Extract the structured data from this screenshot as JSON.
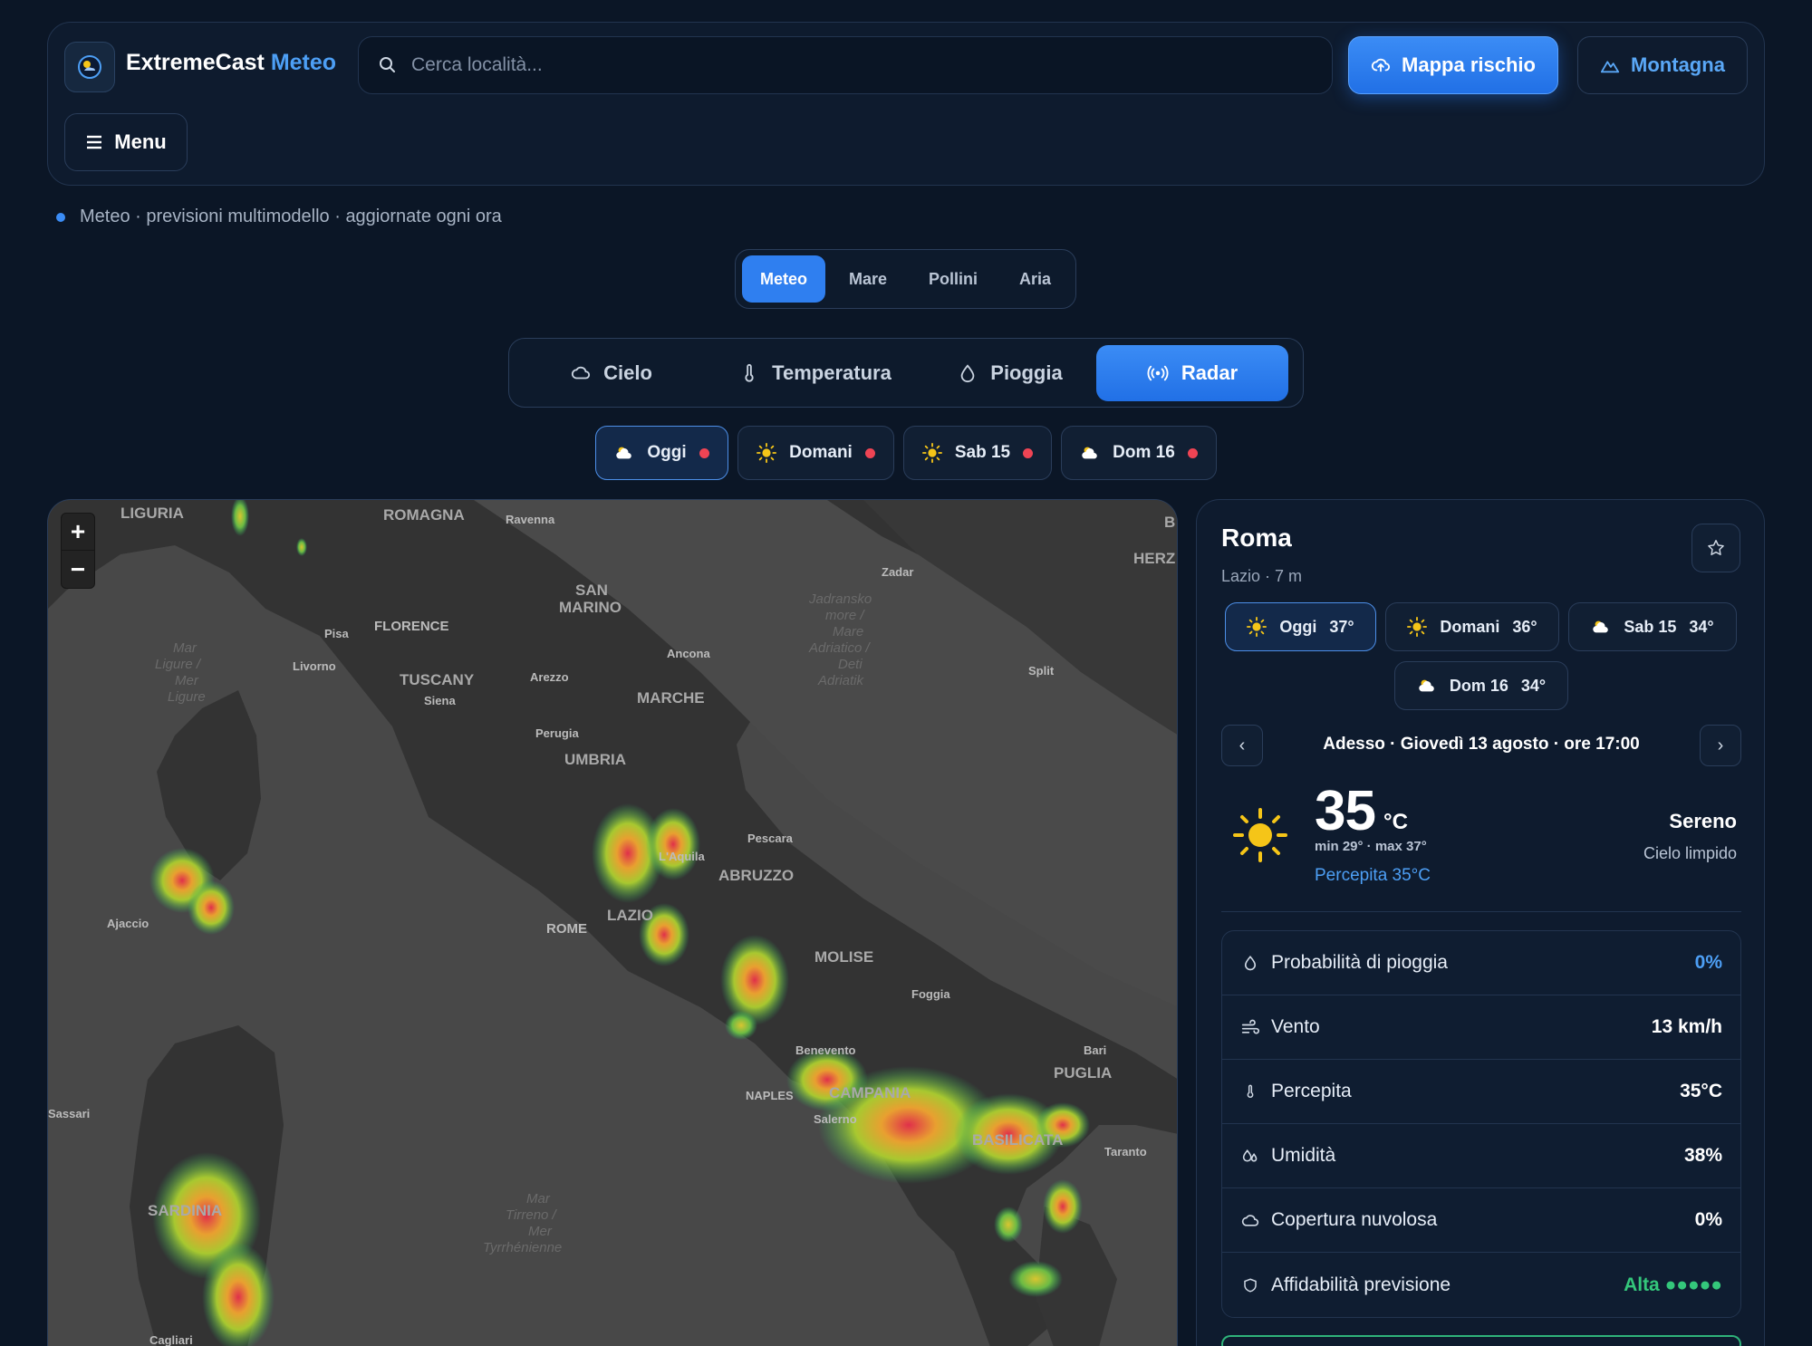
{
  "brand": {
    "name": "ExtremeCast",
    "accent": "Meteo"
  },
  "search": {
    "placeholder": "Cerca località..."
  },
  "header_buttons": {
    "risk": "Mappa rischio",
    "mountain": "Montagna",
    "menu": "Menu"
  },
  "status_line": "Meteo · previsioni multimodello · aggiornate ogni ora",
  "mode_tabs": [
    {
      "label": "Meteo",
      "active": true
    },
    {
      "label": "Mare",
      "active": false
    },
    {
      "label": "Pollini",
      "active": false
    },
    {
      "label": "Aria",
      "active": false
    }
  ],
  "layer_tabs": [
    {
      "label": "Cielo",
      "icon": "cloud-icon",
      "active": false
    },
    {
      "label": "Temperatura",
      "icon": "thermometer-icon",
      "active": false
    },
    {
      "label": "Pioggia",
      "icon": "droplet-icon",
      "active": false
    },
    {
      "label": "Radar",
      "icon": "radar-icon",
      "active": true
    }
  ],
  "day_tabs": [
    {
      "label": "Oggi",
      "icon": "cloud-sun-icon",
      "alert": true,
      "active": true
    },
    {
      "label": "Domani",
      "icon": "sun-icon",
      "alert": true,
      "active": false
    },
    {
      "label": "Sab 15",
      "icon": "sun-icon",
      "alert": true,
      "active": false
    },
    {
      "label": "Dom 16",
      "icon": "cloud-sun-icon",
      "alert": true,
      "active": false
    }
  ],
  "map": {
    "zoom_in": "+",
    "zoom_out": "−",
    "labels": [
      "LIGURIA",
      "ROMAGNA",
      "Ravenna",
      "SAN",
      "MARINO",
      "Zadar",
      "HERZ",
      "FLORENCE",
      "Pisa",
      "Livorno",
      "TUSCANY",
      "Arezzo",
      "Siena",
      "Ancona",
      "MARCHE",
      "Split",
      "Mar",
      "Ligure /",
      "Mer",
      "Ligure",
      "Jadransko",
      "more /",
      "Mare",
      "Adriatico /",
      "Deti",
      "Adriatik",
      "Perugia",
      "UMBRIA",
      "Pescara",
      "L'Aquila",
      "ABRUZZO",
      "Ajaccio",
      "LAZIO",
      "ROME",
      "MOLISE",
      "Foggia",
      "Benevento",
      "Bari",
      "PUGLIA",
      "NAPLES",
      "CAMPANIA",
      "Salerno",
      "BASILICATA",
      "Taranto",
      "Sassari",
      "SARDINIA",
      "Mar",
      "Tirreno /",
      "Mer",
      "Tyrrhénienne",
      "Cagliari",
      "B"
    ]
  },
  "panel": {
    "city": "Roma",
    "region": "Lazio · 7 m",
    "days": [
      {
        "label": "Oggi",
        "temp": "37°",
        "icon": "sun-icon",
        "active": true
      },
      {
        "label": "Domani",
        "temp": "36°",
        "icon": "sun-icon",
        "active": false
      },
      {
        "label": "Sab 15",
        "temp": "34°",
        "icon": "cloud-sun-icon",
        "active": false
      },
      {
        "label": "Dom 16",
        "temp": "34°",
        "icon": "cloud-sun-icon",
        "active": false
      }
    ],
    "now_label": "Adesso · Giovedì 13 agosto · ore 17:00",
    "temperature": "35",
    "unit": "°C",
    "minmax": "min 29° · max 37°",
    "feels_like": "Percepita 35°C",
    "condition": "Sereno",
    "condition_sub": "Cielo limpido",
    "stats": [
      {
        "label": "Probabilità di pioggia",
        "value": "0%",
        "icon": "droplet-icon",
        "color": "blue"
      },
      {
        "label": "Vento",
        "value": "13 km/h",
        "icon": "wind-icon",
        "color": "white"
      },
      {
        "label": "Percepita",
        "value": "35°C",
        "icon": "thermometer-icon",
        "color": "white"
      },
      {
        "label": "Umidità",
        "value": "38%",
        "icon": "humidity-icon",
        "color": "white"
      },
      {
        "label": "Copertura nuvolosa",
        "value": "0%",
        "icon": "cloud-icon",
        "color": "white"
      },
      {
        "label": "Affidabilità previsione",
        "value": "Alta ●●●●●",
        "icon": "shield-icon",
        "color": "green"
      }
    ]
  },
  "colors": {
    "accent": "#2f7ff0",
    "background": "#0b1626",
    "alert": "#ef4454",
    "success": "#34c77b"
  }
}
